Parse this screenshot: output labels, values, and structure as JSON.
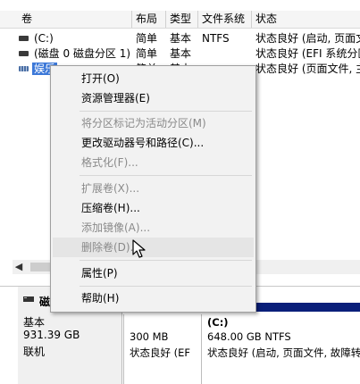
{
  "columns": [
    "卷",
    "布局",
    "类型",
    "文件系统",
    "状态"
  ],
  "volumes": [
    {
      "name": "(C:)",
      "layout": "简单",
      "type": "基本",
      "fs": "NTFS",
      "status": "状态良好 (启动, 页面文"
    },
    {
      "name": "(磁盘 0 磁盘分区 1)",
      "layout": "简单",
      "type": "基本",
      "fs": "",
      "status": "状态良好 (EFI 系统分区"
    },
    {
      "name": "娱乐",
      "layout": "简单",
      "type": "基本",
      "fs": "",
      "status": "状态良好 (页面文件, 主"
    }
  ],
  "context_menu": {
    "items": [
      {
        "label": "打开(O)",
        "enabled": true
      },
      {
        "label": "资源管理器(E)",
        "enabled": true
      },
      {
        "label": "将分区标记为活动分区(M)",
        "enabled": false
      },
      {
        "label": "更改驱动器号和路径(C)...",
        "enabled": true
      },
      {
        "label": "格式化(F)...",
        "enabled": false
      },
      {
        "label": "扩展卷(X)...",
        "enabled": false
      },
      {
        "label": "压缩卷(H)...",
        "enabled": true
      },
      {
        "label": "添加镜像(A)...",
        "enabled": false
      },
      {
        "label": "删除卷(D)...",
        "enabled": false,
        "hovered": true
      },
      {
        "label": "属性(P)",
        "enabled": true
      },
      {
        "label": "帮助(H)",
        "enabled": true
      }
    ]
  },
  "disk": {
    "name": "磁盘 0",
    "type": "基本",
    "size": "931.39 GB",
    "state": "联机"
  },
  "partitions": [
    {
      "size": "300 MB",
      "status": "状态良好 (EF"
    },
    {
      "name": "(C:)",
      "size": "648.00 GB NTFS",
      "status": "状态良好 (启动, 页面文件, 故障转"
    }
  ],
  "colors": {
    "partition_bar": "#0a1f7a",
    "selection": "#3c78d8"
  },
  "icons": {
    "disk_icon": "disk-icon",
    "mouse_cursor": "mouse-cursor-icon",
    "scroll_left": "arrow-left-icon"
  }
}
